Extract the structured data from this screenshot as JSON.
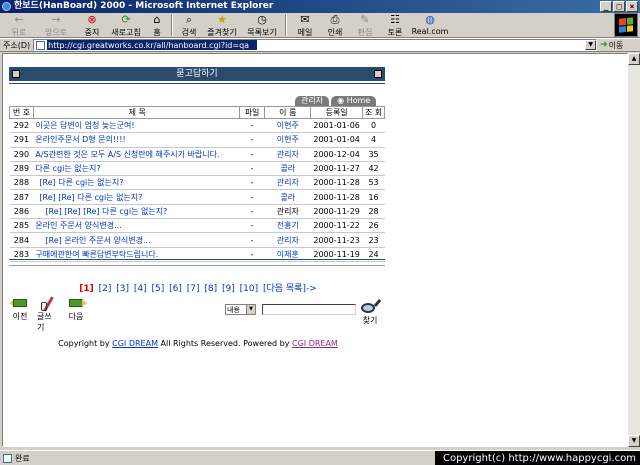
{
  "window": {
    "title": "한보드(HanBoard) 2000 - Microsoft Internet Explorer",
    "controls": [
      "_",
      "□",
      "×"
    ]
  },
  "toolbar": {
    "buttons": [
      {
        "label": "뒤로",
        "icon": "←"
      },
      {
        "label": "앞으로",
        "icon": "→"
      },
      {
        "label": "중지",
        "icon": "⊗"
      },
      {
        "label": "새로고침",
        "icon": "⟳"
      },
      {
        "label": "홈",
        "icon": "⌂"
      },
      {
        "label": "검색",
        "icon": "⌕"
      },
      {
        "label": "즐겨찾기",
        "icon": "★"
      },
      {
        "label": "목록보기",
        "icon": "◷"
      },
      {
        "label": "메일",
        "icon": "✉"
      },
      {
        "label": "인쇄",
        "icon": "⎙"
      },
      {
        "label": "편집",
        "icon": "✎"
      },
      {
        "label": "토론",
        "icon": "☷"
      },
      {
        "label": "Real.com",
        "icon": "◍"
      }
    ]
  },
  "address": {
    "label": "주소(D)",
    "url": "http://cgi.greatworks.co.kr/all/hanboard.cgi?id=qa",
    "go_label": "이동"
  },
  "board": {
    "title": "묻고답하기",
    "tabs": [
      "관리자",
      "Home"
    ],
    "columns": [
      "번 호",
      "제 목",
      "파일",
      "이 름",
      "등록일",
      "조 회"
    ],
    "rows": [
      {
        "num": "292",
        "title": "이곳은 답변이 엄청 늦는군여!",
        "file": "-",
        "name": "이현주",
        "date": "2001-01-06",
        "hits": "0",
        "indent": 0,
        "link": true
      },
      {
        "num": "291",
        "title": "온라인주문서 D형 문의!!!!",
        "file": "-",
        "name": "이현주",
        "date": "2001-01-04",
        "hits": "4",
        "indent": 0,
        "link": true
      },
      {
        "num": "290",
        "title": "A/S관련한 것은 모두 A/S 신청란에 해주시기 바랍니다.",
        "file": "-",
        "name": "관리자",
        "date": "2000-12-04",
        "hits": "35",
        "indent": 0,
        "link": true
      },
      {
        "num": "289",
        "title": "다른 cgi는 없는지?",
        "file": "-",
        "name": "콜라",
        "date": "2000-11-27",
        "hits": "42",
        "indent": 0,
        "link": true
      },
      {
        "num": "288",
        "title": "[Re] 다른 cgi는 없는지?",
        "file": "-",
        "name": "관리자",
        "date": "2000-11-28",
        "hits": "53",
        "indent": 1,
        "link": true
      },
      {
        "num": "287",
        "title": "[Re] [Re] 다른 cgi는 없는지?",
        "file": "-",
        "name": "콜라",
        "date": "2000-11-28",
        "hits": "16",
        "indent": 1,
        "link": true
      },
      {
        "num": "286",
        "title": "[Re] [Re] [Re] 다른 cgi는 없는지?",
        "file": "-",
        "name": "관리자",
        "date": "2000-11-29",
        "hits": "28",
        "indent": 2,
        "link": false
      },
      {
        "num": "285",
        "title": "온라인 주문서 양식변경...",
        "file": "-",
        "name": "전홍기",
        "date": "2000-11-22",
        "hits": "26",
        "indent": 0,
        "link": true
      },
      {
        "num": "284",
        "title": "[Re] 온라인 주문서 양식변경...",
        "file": "-",
        "name": "관리자",
        "date": "2000-11-23",
        "hits": "23",
        "indent": 2,
        "link": true
      },
      {
        "num": "283",
        "title": "구매에관한여 빠른답변부탁드립니다.",
        "file": "-",
        "name": "이제훈",
        "date": "2000-11-19",
        "hits": "24",
        "indent": 0,
        "link": true
      }
    ],
    "pager": {
      "current": "[1]",
      "pages": [
        "[2]",
        "[3]",
        "[4]",
        "[5]",
        "[6]",
        "[7]",
        "[8]",
        "[9]",
        "[10]"
      ],
      "next": "[다음 목록]->"
    },
    "nav": {
      "prev": "이전",
      "write": "글쓰기",
      "next": "다음",
      "find": "찾기"
    },
    "search": {
      "select_value": "내용",
      "input_value": ""
    },
    "copyright": {
      "prefix": "Copyright by ",
      "brand1": "CGI DREAM",
      "middle": " All Rights Reserved. Powered by ",
      "brand2": "CGI DREAM"
    }
  },
  "status": {
    "text": "완료",
    "overlay": "Copyright(c) http://www.happycgi.com"
  }
}
